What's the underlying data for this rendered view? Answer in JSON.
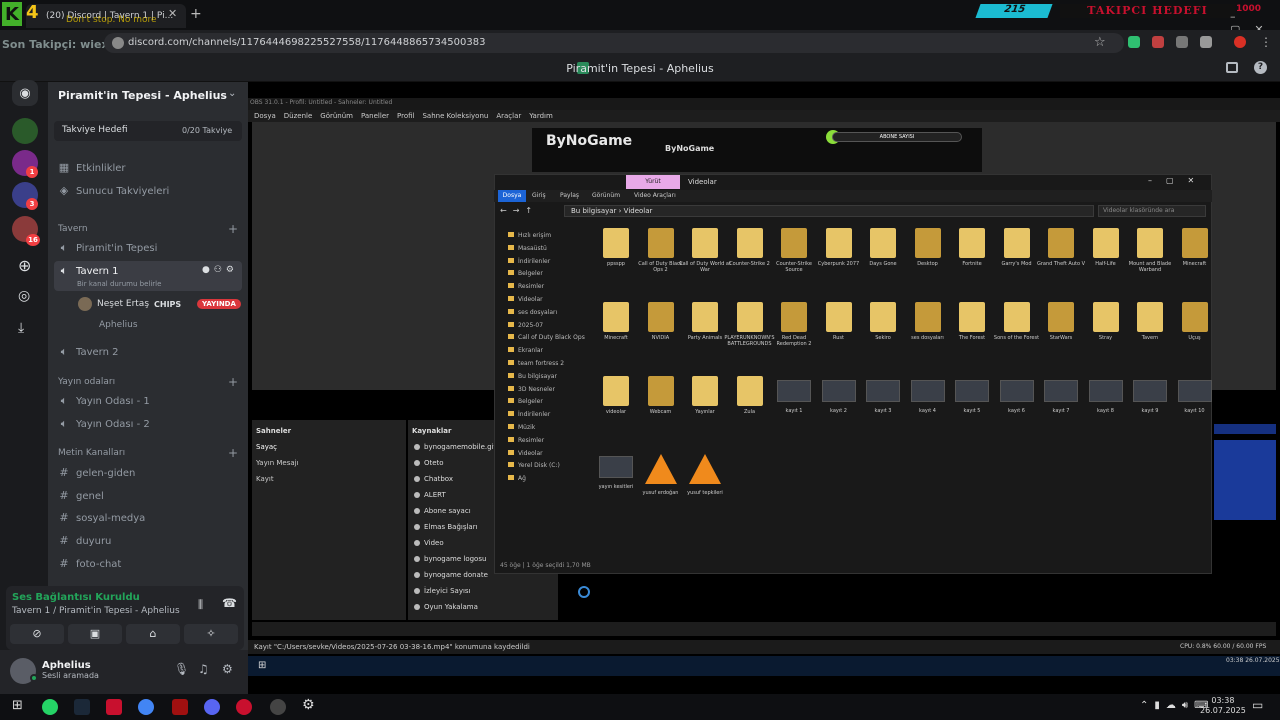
{
  "browser": {
    "tab_title": "(20) Discord | Tavern 1 | Pi...",
    "overlay_text": "Don't stop. No more",
    "overlay_counter": "215",
    "overlay_goal_label": "TAKIPCI HEDEFI",
    "overlay_goal_value": "1000",
    "overlay_last_follower": "Son Takipçi: wiexyz",
    "url": "discord.com/channels/1176444698225527558/1176448865734500383"
  },
  "discord": {
    "top_title": "Piramit'in Tepesi - Aphelius",
    "server_name": "Piramit'in Tepesi - Aphelius",
    "boost": {
      "label": "Takviye Hedefi",
      "value": "0/20 Takviye"
    },
    "nav": [
      {
        "label": "Etkinlikler"
      },
      {
        "label": "Sunucu Takviyeleri"
      }
    ],
    "rail_badges": [
      "1",
      "3",
      "16"
    ],
    "categories": {
      "tavern": "Tavern",
      "yayin": "Yayın odaları",
      "metin": "Metin Kanalları"
    },
    "channels_tavern": [
      "Piramit'in Tepesi",
      "Tavern 1",
      "Tavern 2"
    ],
    "tavern1_status": "Bir kanal durumu belirle",
    "voice_user": {
      "name": "Neşet Ertaş",
      "tag": "CHIPS",
      "live": "YAYINDA"
    },
    "voice_user2": "Aphelius",
    "channels_yayin": [
      "Yayın Odası - 1",
      "Yayın Odası - 2"
    ],
    "channels_text": [
      "gelen-giden",
      "genel",
      "sosyal-medya",
      "duyuru",
      "foto-chat"
    ],
    "voice_panel": {
      "status": "Ses Bağlantısı Kuruldu",
      "channel": "Tavern 1 / Piramit'in Tepesi - Aphelius"
    },
    "user": {
      "name": "Aphelius",
      "status": "Sesli aramada"
    }
  },
  "stream": {
    "obs_title": "OBS 31.0.1 - Profil: Untitled - Sahneler: Untitled",
    "obs_menu": [
      "Dosya",
      "Düzenle",
      "Görünüm",
      "Paneller",
      "Profil",
      "Sahne Koleksiyonu",
      "Araçlar",
      "Yardım"
    ],
    "banner_brand": "ByNoGame",
    "banner_brand_small": "ByNoGame",
    "abone_label": "ABONE SAYISI",
    "scenes_header": "Sahneler",
    "scenes": [
      "Sayaç",
      "Yayın Mesajı",
      "Kayıt"
    ],
    "sources_header": "Kaynaklar",
    "sources": [
      "bynogamemobile.gif",
      "Oteto",
      "Chatbox",
      "ALERT",
      "Abone sayacı",
      "Elmas Bağışları",
      "Video",
      "bynogame logosu",
      "bynogame donate",
      "İzleyici Sayısı",
      "Oyun Yakalama"
    ],
    "record_status": "Kayıt \"C:/Users/sevke/Videos/2025-07-26 03-38-16.mp4\" konumuna kaydedildi",
    "cpu": "CPU: 0.8%   60.00 / 60.00 FPS",
    "inner_clock": "03:38\n26.07.2025"
  },
  "explorer": {
    "tab_yurut": "Yürüt",
    "title": "Videolar",
    "ribbon": [
      "Dosya",
      "Giriş",
      "Paylaş",
      "Görünüm",
      "Video Araçları"
    ],
    "path": "Bu bilgisayar  ›  Videolar",
    "search_placeholder": "Videolar klasöründe ara",
    "sidebar": [
      "Hızlı erişim",
      "Masaüstü",
      "İndirilenler",
      "Belgeler",
      "Resimler",
      "Videolar",
      "ses dosyaları",
      "2025-07",
      "Call of Duty Black Ops",
      "Ekranlar",
      "team fortress 2",
      "Bu bilgisayar",
      "3D Nesneler",
      "Belgeler",
      "İndirilenler",
      "Müzik",
      "Resimler",
      "Videolar",
      "Yerel Disk (C:)",
      "Ağ"
    ],
    "items_row1": [
      "ppsspp",
      "Call of Duty Black Ops 2",
      "Call of Duty World at War",
      "Counter-Strike 2",
      "Counter-Strike Source",
      "Cyberpunk 2077",
      "Days Gone",
      "Desktop",
      "Fortnite",
      "Garry's Mod",
      "Grand Theft Auto V",
      "Half-Life",
      "Mount and Blade Warband",
      "Minecraft"
    ],
    "items_row2": [
      "Minecraft",
      "NVIDIA",
      "Party Animals",
      "PLAYERUNKNOWN'S BATTLEGROUNDS",
      "Red Dead Redemption 2",
      "Rust",
      "Sekiro",
      "ses dosyaları",
      "The Forest",
      "Sons of the Forest",
      "StarWars",
      "Stray",
      "Tavern",
      "Uçuş"
    ],
    "items_row3": [
      "videolar",
      "Webcam",
      "Yayınlar",
      "Zula",
      "kayıt 1",
      "kayıt 2",
      "kayıt 3",
      "kayıt 4",
      "kayıt 5",
      "kayıt 6",
      "kayıt 7",
      "kayıt 8",
      "kayıt 9",
      "kayıt 10"
    ],
    "items_row4": [
      "yayın kesitleri",
      "yusuf erdoğan",
      "yusuf tepkileri"
    ],
    "footer": "45 öğe   |   1 öğe seçildi  1,70 MB"
  },
  "taskbar": {
    "time": "03:38",
    "date": "26.07.2025"
  }
}
